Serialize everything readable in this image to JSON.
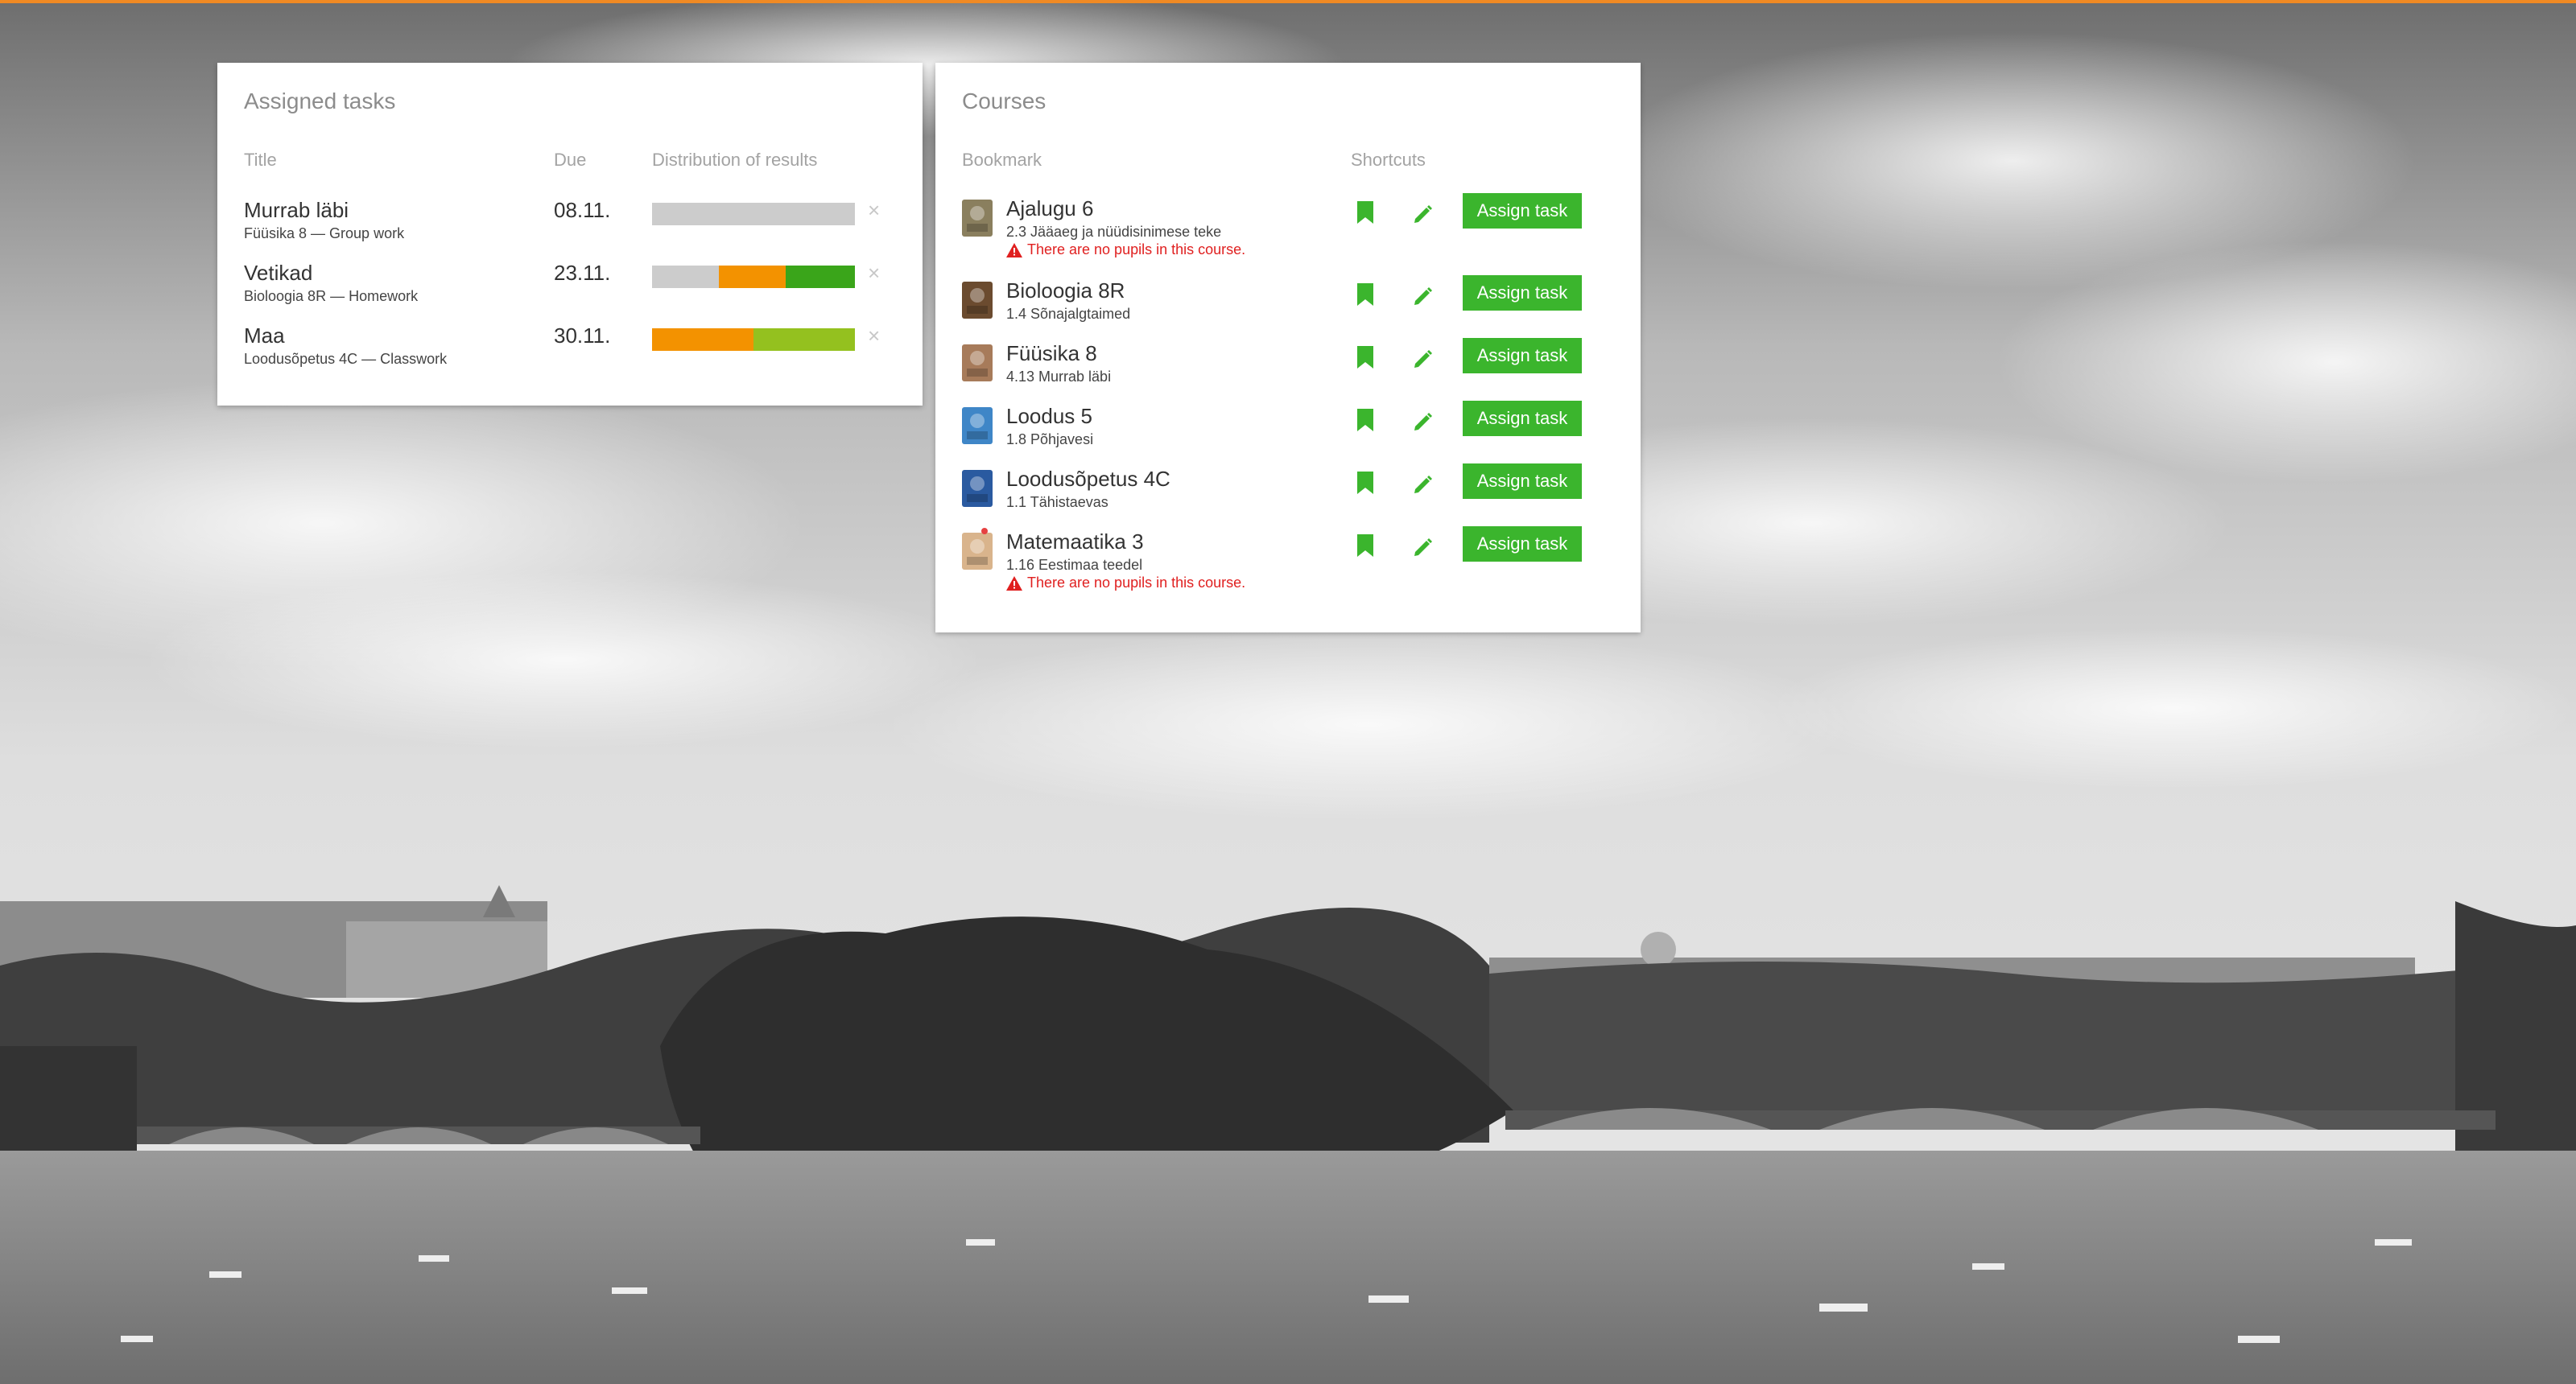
{
  "colors": {
    "accent": "#f08a24",
    "bar_grey": "#cccccc",
    "bar_orange": "#f39200",
    "bar_green": "#3aa51a",
    "bar_lightgreen": "#94c11f",
    "button_green": "#3bb52d",
    "warning_red": "#e02020"
  },
  "tasks_card": {
    "title": "Assigned tasks",
    "headers": {
      "title": "Title",
      "due": "Due",
      "distribution": "Distribution of results"
    },
    "rows": [
      {
        "title": "Murrab läbi",
        "subtitle": "Füüsika 8 — Group work",
        "due": "08.11.",
        "distribution": [
          {
            "fraction": 1.0,
            "color": "#cccccc"
          }
        ]
      },
      {
        "title": "Vetikad",
        "subtitle": "Bioloogia 8R — Homework",
        "due": "23.11.",
        "distribution": [
          {
            "fraction": 0.33,
            "color": "#cccccc"
          },
          {
            "fraction": 0.33,
            "color": "#f39200"
          },
          {
            "fraction": 0.34,
            "color": "#3aa51a"
          }
        ]
      },
      {
        "title": "Maa",
        "subtitle": "Loodusõpetus 4C — Classwork",
        "due": "30.11.",
        "distribution": [
          {
            "fraction": 0.5,
            "color": "#f39200"
          },
          {
            "fraction": 0.5,
            "color": "#94c11f"
          }
        ]
      }
    ],
    "remove_icon": "close-icon",
    "remove_glyph": "×"
  },
  "courses_card": {
    "title": "Courses",
    "headers": {
      "bookmark": "Bookmark",
      "shortcuts": "Shortcuts"
    },
    "assign_label": "Assign task",
    "bookmark_icon": "bookmark-icon",
    "edit_icon": "pencil-icon",
    "rows": [
      {
        "name": "Ajalugu 6",
        "lesson": "2.3 Jääaeg ja nüüdisinimese teke",
        "warning": "There are no pupils in this course.",
        "thumb_color": "#8a7f5e"
      },
      {
        "name": "Bioloogia 8R",
        "lesson": "1.4 Sõnajalgtaimed",
        "warning": "",
        "thumb_color": "#6b4b2f"
      },
      {
        "name": "Füüsika 8",
        "lesson": "4.13 Murrab läbi",
        "warning": "",
        "thumb_color": "#a77b5a"
      },
      {
        "name": "Loodus 5",
        "lesson": "1.8 Põhjavesi",
        "warning": "",
        "thumb_color": "#3f86c7"
      },
      {
        "name": "Loodusõpetus 4C",
        "lesson": "1.1 Tähistaevas",
        "warning": "",
        "thumb_color": "#2a5aa0"
      },
      {
        "name": "Matemaatika 3",
        "lesson": "1.16 Eestimaa teedel",
        "warning": "There are no pupils in this course.",
        "thumb_color": "#d9b48c"
      }
    ]
  }
}
